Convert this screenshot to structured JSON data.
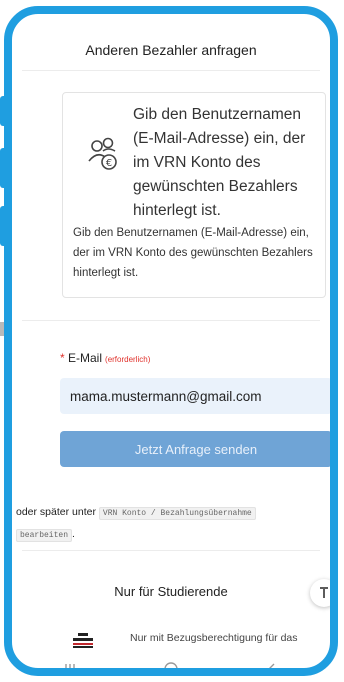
{
  "dialog": {
    "title": "Anderen Bezahler anfragen"
  },
  "info_card": {
    "icon": "users-euro-icon",
    "large_text": "Gib den Benutzernamen (E-Mail-Adresse) ein, der im VRN Konto des gewünschten Bezahlers hinterlegt ist.",
    "small_text": "Gib den Benutzernamen (E-Mail-Adresse) ein, der im VRN Konto des gewünschten Bezahlers hinterlegt ist."
  },
  "form": {
    "email_label": "E-Mail",
    "required_star": "*",
    "required_hint": "(erforderlich)",
    "email_value": "mama.mustermann@gmail.com",
    "submit_label": "Jetzt Anfrage senden"
  },
  "later_hint": {
    "prefix": "oder später unter",
    "path_part1": "VRN Konto / Bezahlungsübernahme",
    "path_part2": "bearbeiten",
    "suffix": "."
  },
  "section": {
    "title": "Nur für Studierende",
    "item_text": "Nur mit Bezugsberechtigung für das",
    "item_icon": "stack-icon"
  },
  "scroll_top": {
    "icon": "scroll-to-top-icon"
  },
  "navbar": {
    "recents_icon": "recents-icon",
    "home_icon": "home-icon",
    "back_icon": "back-icon"
  },
  "colors": {
    "accent": "#1f9ee0",
    "button_bg": "#6fa4d6",
    "input_bg": "#eaf2fb",
    "required": "#e0312b"
  }
}
